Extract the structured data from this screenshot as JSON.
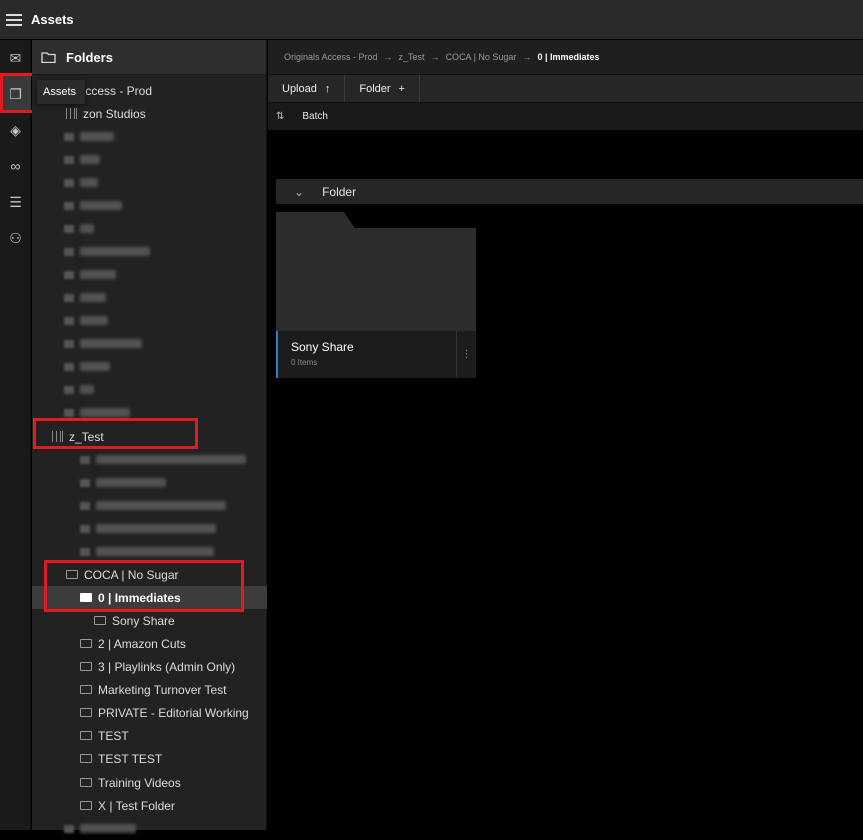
{
  "app": {
    "title": "Assets"
  },
  "rail": {
    "items": [
      {
        "icon": "inbox-icon",
        "glyph": "✉"
      },
      {
        "icon": "assets-icon",
        "glyph": "❐"
      },
      {
        "icon": "layers-icon",
        "glyph": "◈"
      },
      {
        "icon": "link-icon",
        "glyph": "∞"
      },
      {
        "icon": "review-icon",
        "glyph": "☰"
      },
      {
        "icon": "users-icon",
        "glyph": "⚇"
      }
    ],
    "tooltip": "Assets"
  },
  "folders": {
    "title": "Folders",
    "tree": [
      {
        "label": "Originals Access - Prod",
        "visible": "ls Access - Prod",
        "indent": 34,
        "kind": "text"
      },
      {
        "label": "Amazon Studios",
        "visible": "zon Studios",
        "indent": 34,
        "kind": "lib"
      },
      {
        "blur": 34,
        "indent": 32
      },
      {
        "blur": 20,
        "indent": 32
      },
      {
        "blur": 18,
        "indent": 32
      },
      {
        "blur": 42,
        "indent": 32
      },
      {
        "blur": 14,
        "indent": 32
      },
      {
        "blur": 70,
        "indent": 32
      },
      {
        "blur": 36,
        "indent": 32
      },
      {
        "blur": 26,
        "indent": 32
      },
      {
        "blur": 28,
        "indent": 32
      },
      {
        "blur": 62,
        "indent": 32
      },
      {
        "blur": 30,
        "indent": 32
      },
      {
        "blur": 14,
        "indent": 32
      },
      {
        "blur": 50,
        "indent": 32
      },
      {
        "label": "z_Test",
        "indent": 20,
        "kind": "lib"
      },
      {
        "blur": 150,
        "indent": 48
      },
      {
        "blur": 70,
        "indent": 48
      },
      {
        "blur": 130,
        "indent": 48
      },
      {
        "blur": 120,
        "indent": 48
      },
      {
        "blur": 118,
        "indent": 48
      },
      {
        "label": "COCA | No Sugar",
        "indent": 34,
        "kind": "folder"
      },
      {
        "label": "0 | Immediates",
        "indent": 48,
        "kind": "folder",
        "selected": true
      },
      {
        "label": "Sony Share",
        "indent": 62,
        "kind": "folder"
      },
      {
        "label": "2 | Amazon Cuts",
        "indent": 48,
        "kind": "folder"
      },
      {
        "label": "3 | Playlinks (Admin Only)",
        "indent": 48,
        "kind": "folder"
      },
      {
        "label": "Marketing Turnover Test",
        "indent": 48,
        "kind": "folder"
      },
      {
        "label": "PRIVATE - Editorial Working",
        "indent": 48,
        "kind": "folder"
      },
      {
        "label": "TEST",
        "indent": 48,
        "kind": "folder"
      },
      {
        "label": "TEST TEST",
        "indent": 48,
        "kind": "folder"
      },
      {
        "label": "Training Videos",
        "indent": 48,
        "kind": "folder"
      },
      {
        "label": "X | Test Folder",
        "indent": 48,
        "kind": "folder"
      },
      {
        "blur": 56,
        "indent": 32
      }
    ]
  },
  "breadcrumb": [
    {
      "label": "Originals Access - Prod"
    },
    {
      "label": "z_Test"
    },
    {
      "label": "COCA | No Sugar"
    },
    {
      "label": "0 | Immediates",
      "current": true
    }
  ],
  "toolbar": {
    "upload_label": "Upload",
    "folder_label": "Folder"
  },
  "subbar": {
    "batch_label": "Batch"
  },
  "group": {
    "label": "Folder"
  },
  "card": {
    "name": "Sony Share",
    "count": "0 Items"
  },
  "colors": {
    "highlight": "#e21b23",
    "card_accent": "#2f7dd1"
  }
}
